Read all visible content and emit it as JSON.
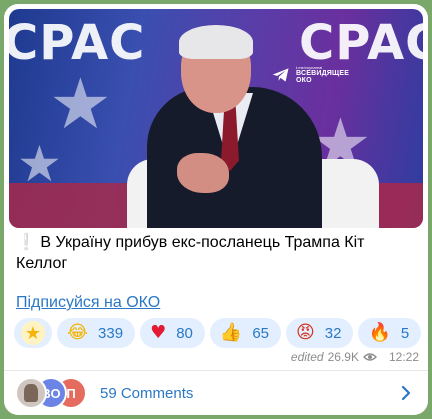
{
  "post": {
    "text_prefix": "❕",
    "text": "В Україну прибув екс-посланець Трампа Кіт Келлог",
    "subscribe_link": "Підписуйся на ОКО"
  },
  "image": {
    "backdrop_text": "CPAC",
    "watermark_small": "t.me/voynareal",
    "watermark_big_line1": "ВСЕВИДЯЩЕЕ",
    "watermark_big_line2": "ОКО"
  },
  "reactions": [
    {
      "emoji": "star",
      "count": ""
    },
    {
      "emoji": "laughing-face",
      "glyph": "😂",
      "count": "339"
    },
    {
      "emoji": "red-heart",
      "glyph": "♥",
      "count": "80"
    },
    {
      "emoji": "thumbs-up",
      "glyph": "👍",
      "count": "65"
    },
    {
      "emoji": "angry-face",
      "glyph": "😡",
      "count": "32"
    },
    {
      "emoji": "fire",
      "glyph": "🔥",
      "count": "5"
    }
  ],
  "meta": {
    "edited": "edited",
    "views": "26.9K",
    "time": "12:22"
  },
  "comments": {
    "avatar_initials": [
      "",
      "ВО",
      "П"
    ],
    "label": "59 Comments"
  },
  "colors": {
    "link": "#2a78c5",
    "reaction_bg": "#e3efff",
    "chat_bg": "#7aa86a"
  }
}
